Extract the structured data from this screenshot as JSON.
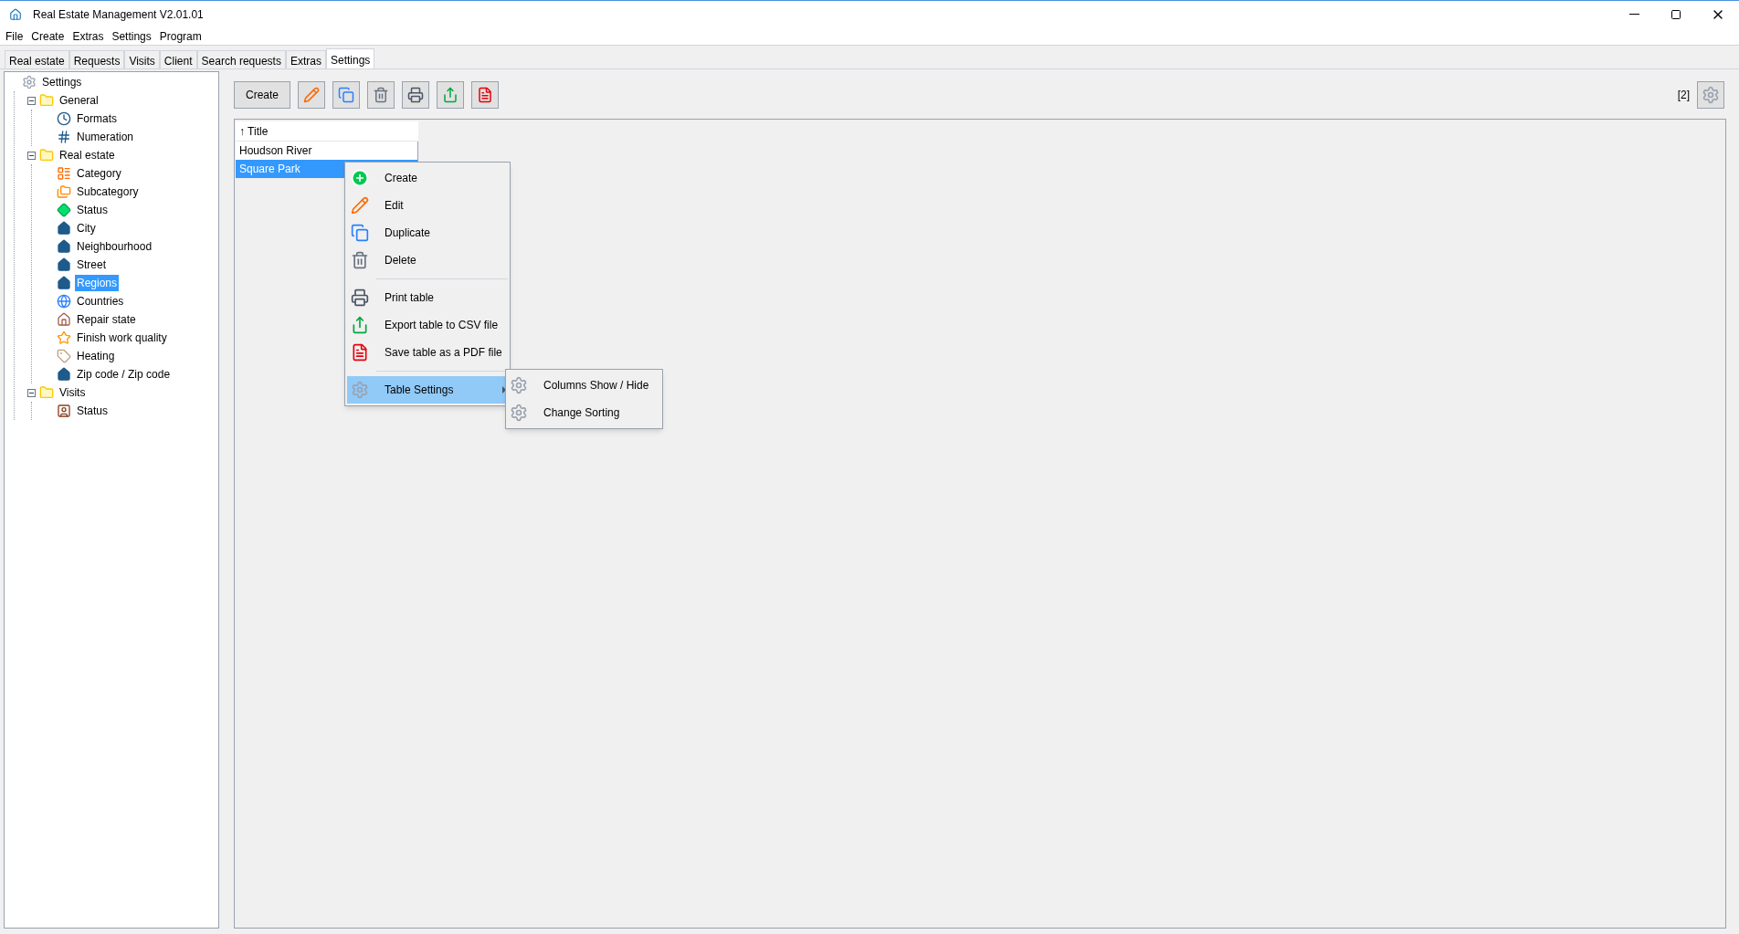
{
  "window": {
    "title": "Real Estate Management V2.01.01"
  },
  "menu_bar": [
    "File",
    "Create",
    "Extras",
    "Settings",
    "Program"
  ],
  "tabs": [
    {
      "label": "Real estate",
      "selected": false
    },
    {
      "label": "Requests",
      "selected": false
    },
    {
      "label": "Visits",
      "selected": false
    },
    {
      "label": "Client",
      "selected": false
    },
    {
      "label": "Search requests",
      "selected": false
    },
    {
      "label": "Extras",
      "selected": false
    },
    {
      "label": "Settings",
      "selected": true
    }
  ],
  "tree": [
    {
      "label": "Settings",
      "selected": false,
      "children": [
        {
          "label": "General",
          "selected": false,
          "expanded": true,
          "children": [
            {
              "label": "Formats",
              "selected": false
            },
            {
              "label": "Numeration",
              "selected": false
            }
          ]
        },
        {
          "label": "Real estate",
          "selected": false,
          "expanded": true,
          "children": [
            {
              "label": "Category",
              "selected": false
            },
            {
              "label": "Subcategory",
              "selected": false
            },
            {
              "label": "Status",
              "selected": false
            },
            {
              "label": "City",
              "selected": false
            },
            {
              "label": "Neighbourhood",
              "selected": false
            },
            {
              "label": "Street",
              "selected": false
            },
            {
              "label": "Regions",
              "selected": true
            },
            {
              "label": "Countries",
              "selected": false
            },
            {
              "label": "Repair state",
              "selected": false
            },
            {
              "label": "Finish work quality",
              "selected": false
            },
            {
              "label": "Heating",
              "selected": false
            },
            {
              "label": "Zip code / Zip code",
              "selected": false
            }
          ]
        },
        {
          "label": "Visits",
          "selected": false,
          "expanded": true,
          "children": [
            {
              "label": "Status",
              "selected": false
            }
          ]
        }
      ]
    }
  ],
  "toolbar": {
    "create_button": "Create",
    "count": "[2]"
  },
  "table": {
    "columns": [
      "↑ Title"
    ],
    "rows": [
      {
        "title": "Houdson River",
        "selected": false
      },
      {
        "title": "Square Park",
        "selected": true
      }
    ]
  },
  "context_menu": [
    {
      "kind": "item",
      "label": "Create",
      "selected": false
    },
    {
      "kind": "item",
      "label": "Edit",
      "selected": false
    },
    {
      "kind": "item",
      "label": "Duplicate",
      "selected": false
    },
    {
      "kind": "item",
      "label": "Delete",
      "selected": false
    },
    {
      "kind": "separator"
    },
    {
      "kind": "item",
      "label": "Print table",
      "selected": false
    },
    {
      "kind": "item",
      "label": "Export table to CSV file",
      "selected": false
    },
    {
      "kind": "item",
      "label": "Save table as a PDF file",
      "selected": false
    },
    {
      "kind": "separator"
    },
    {
      "kind": "submenu",
      "label": "Table Settings",
      "selected": true,
      "children": [
        {
          "label": "Columns Show / Hide",
          "selected": false
        },
        {
          "label": "Change Sorting",
          "selected": false
        }
      ]
    }
  ]
}
